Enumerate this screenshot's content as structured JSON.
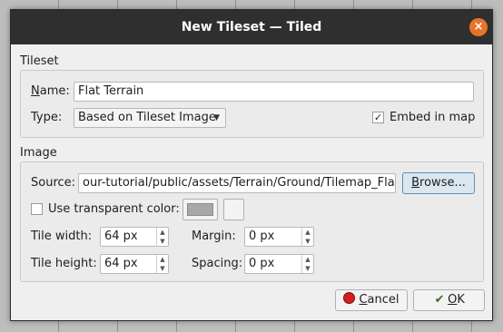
{
  "window": {
    "title": "New Tileset — Tiled",
    "close_glyph": "×"
  },
  "tileset_section": {
    "label": "Tileset",
    "name_label_first": "N",
    "name_label_rest": "ame:",
    "name_value": "Flat Terrain",
    "type_label": "Type:",
    "type_value": "Based on Tileset Image",
    "embed_label": "Embed in map",
    "embed_checked": "✓"
  },
  "image_section": {
    "label": "Image",
    "source_label": "Source:",
    "source_value": "our-tutorial/public/assets/Terrain/Ground/Tilemap_Flat.png",
    "browse_label_first": "B",
    "browse_label_rest": "rowse...",
    "transparent_label": "Use transparent color:",
    "tile_width_label": "Tile width:",
    "tile_width_value": "64 px",
    "tile_height_label": "Tile height:",
    "tile_height_value": "64 px",
    "margin_label": "Margin:",
    "margin_value": "0 px",
    "spacing_label": "Spacing:",
    "spacing_value": "0 px"
  },
  "buttons": {
    "cancel_first": "C",
    "cancel_rest": "ancel",
    "ok_first": "O",
    "ok_rest": "K"
  },
  "icons": {
    "spin_up": "▲",
    "spin_down": "▼",
    "caret": "▼",
    "ok_glyph": "✔"
  },
  "colors": {
    "titlebar": "#2f2f2f",
    "close": "#e8742a",
    "swatch": "#a8a8a8"
  }
}
